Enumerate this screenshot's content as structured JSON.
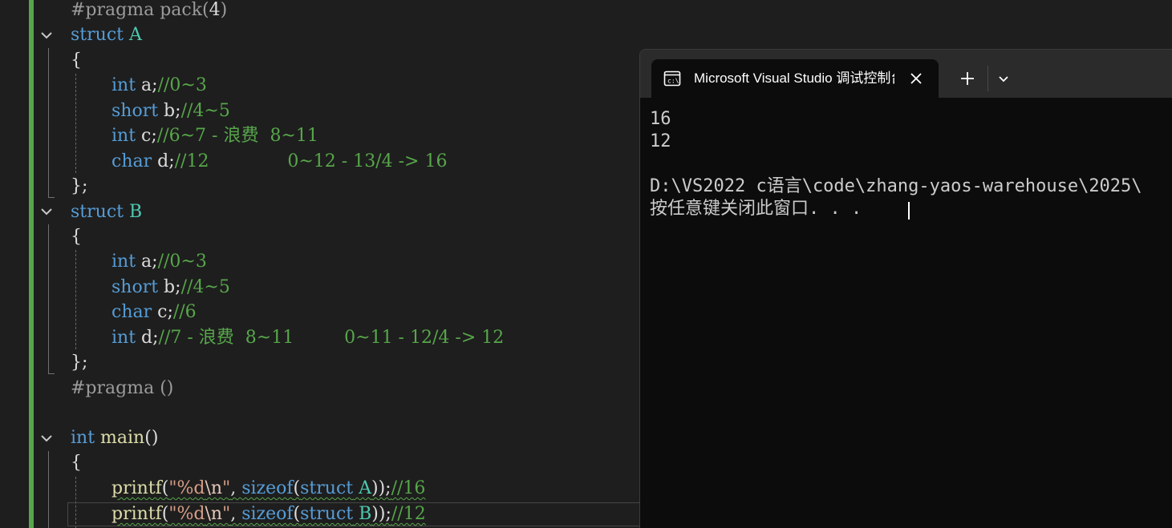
{
  "editor": {
    "lines": [
      [
        [
          "#pragma pack(",
          "pp"
        ],
        [
          "4",
          "pl"
        ],
        [
          ")",
          "pp"
        ]
      ],
      [
        [
          "struct",
          "kw"
        ],
        [
          " ",
          "pl"
        ],
        [
          "A",
          "type"
        ]
      ],
      [
        [
          "{",
          "pl"
        ]
      ],
      [
        [
          "int",
          "kw"
        ],
        [
          " a;",
          "pl"
        ],
        [
          "//0~3",
          "cm"
        ]
      ],
      [
        [
          "short",
          "kw"
        ],
        [
          " b;",
          "pl"
        ],
        [
          "//4~5",
          "cm"
        ]
      ],
      [
        [
          "int",
          "kw"
        ],
        [
          " c;",
          "pl"
        ],
        [
          "//6~7 - 浪费  8~11",
          "cm"
        ]
      ],
      [
        [
          "char",
          "kw"
        ],
        [
          " d;",
          "pl"
        ],
        [
          "//12              0~12 - 13/4 -> 16",
          "cm"
        ]
      ],
      [
        [
          "};",
          "pl"
        ]
      ],
      [
        [
          "struct",
          "kw"
        ],
        [
          " ",
          "pl"
        ],
        [
          "B",
          "type"
        ]
      ],
      [
        [
          "{",
          "pl"
        ]
      ],
      [
        [
          "int",
          "kw"
        ],
        [
          " a;",
          "pl"
        ],
        [
          "//0~3",
          "cm"
        ]
      ],
      [
        [
          "short",
          "kw"
        ],
        [
          " b;",
          "pl"
        ],
        [
          "//4~5",
          "cm"
        ]
      ],
      [
        [
          "char",
          "kw"
        ],
        [
          " c;",
          "pl"
        ],
        [
          "//6",
          "cm"
        ]
      ],
      [
        [
          "int",
          "kw"
        ],
        [
          " d;",
          "pl"
        ],
        [
          "//7 - 浪费  8~11         0~11 - 12/4 -> 12",
          "cm"
        ]
      ],
      [
        [
          "};",
          "pl"
        ]
      ],
      [
        [
          "#pragma ()",
          "pp"
        ]
      ],
      [],
      [
        [
          "int",
          "kw"
        ],
        [
          " ",
          "pl"
        ],
        [
          "main",
          "fn"
        ],
        [
          "()",
          "pl"
        ]
      ],
      [
        [
          "{",
          "pl"
        ]
      ],
      [
        [
          "printf",
          "fn"
        ],
        [
          "(",
          "pl"
        ],
        [
          "\"%d",
          "str"
        ],
        [
          "\\n",
          "esc"
        ],
        [
          "\"",
          "str"
        ],
        [
          ", ",
          "pl"
        ],
        [
          "sizeof",
          "kw"
        ],
        [
          "(",
          "pl"
        ],
        [
          "struct",
          "kw"
        ],
        [
          " ",
          "pl"
        ],
        [
          "A",
          "type"
        ],
        [
          "));",
          "pl"
        ],
        [
          "//16",
          "cm"
        ]
      ],
      [
        [
          "printf",
          "fn"
        ],
        [
          "(",
          "pl"
        ],
        [
          "\"%d",
          "str"
        ],
        [
          "\\n",
          "esc"
        ],
        [
          "\"",
          "str"
        ],
        [
          ", ",
          "pl"
        ],
        [
          "sizeof",
          "kw"
        ],
        [
          "(",
          "pl"
        ],
        [
          "struct",
          "kw"
        ],
        [
          " ",
          "pl"
        ],
        [
          "B",
          "type"
        ],
        [
          "));",
          "pl"
        ],
        [
          "//12",
          "cm"
        ]
      ]
    ]
  },
  "terminal": {
    "tab_title": "Microsoft Visual Studio 调试控制台",
    "lines": [
      "16",
      "12",
      "",
      "D:\\VS2022 c语言\\code\\zhang-yaos-warehouse\\2025\\",
      "按任意键关闭此窗口. . ."
    ]
  },
  "colors": {
    "keyword": "#569cd6",
    "type": "#4ec9b0",
    "comment": "#57a64a",
    "preprocessor": "#9b9b9b",
    "function": "#dcdcaa",
    "string": "#d69d85",
    "plain": "#dcdcdc",
    "terminal_bg": "#0c0c0c",
    "editor_bg": "#1e1e1e"
  },
  "icons": {
    "fold": "chevron-down-icon",
    "console": "console-icon",
    "close": "close-icon",
    "new_tab": "plus-icon",
    "dropdown": "chevron-down-icon"
  }
}
